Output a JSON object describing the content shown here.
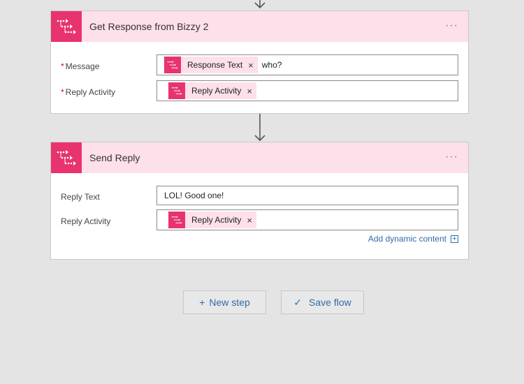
{
  "steps": [
    {
      "title": "Get Response from Bizzy 2",
      "menu": "···",
      "fields": [
        {
          "label": "Message",
          "required": "*",
          "tokens": [
            {
              "label": "Response Text",
              "remove": "×"
            }
          ],
          "text": "who?"
        },
        {
          "label": "Reply Activity",
          "required": "*",
          "tokens": [
            {
              "label": "Reply Activity",
              "remove": "×"
            }
          ]
        }
      ]
    },
    {
      "title": "Send Reply",
      "menu": "···",
      "fields": [
        {
          "label": "Reply Text",
          "value": "LOL!  Good one!"
        },
        {
          "label": "Reply Activity",
          "tokens": [
            {
              "label": "Reply Activity",
              "remove": "×"
            }
          ]
        }
      ],
      "add_dynamic_content": "Add dynamic content",
      "add_dynamic_icon": "+"
    }
  ],
  "actions": {
    "new_step": {
      "glyph": "+",
      "label": "New step"
    },
    "save_flow": {
      "glyph": "✓",
      "label": "Save flow"
    }
  },
  "colors": {
    "accent": "#e8336e",
    "header_bg": "#fde0ea",
    "link": "#2f6ba8",
    "required": "#d0021b"
  },
  "icons": {
    "step_icon": "flow-connector-icon",
    "menu_icon": "more-options-icon"
  }
}
